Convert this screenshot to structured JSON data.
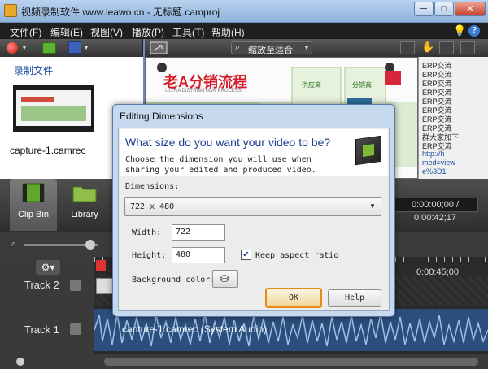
{
  "window": {
    "title": "视频录制软件 www.leawo.cn - 无标题.camproj",
    "min": "─",
    "max": "□",
    "close": "✕"
  },
  "menu": {
    "items": [
      "文件(F)",
      "编辑(E)",
      "视图(V)",
      "播放(P)",
      "工具(T)",
      "帮助(H)"
    ]
  },
  "help": {
    "question": "?"
  },
  "clip_bin": {
    "section_title": "录制文件",
    "clip_name": "capture-1.camrec"
  },
  "preview_toolbar": {
    "zoom_label": "缩放至适合"
  },
  "preview": {
    "banner_text": "老A分销流程",
    "sub_text": "ULTRA DISTRIBUTION PROCESS",
    "node1": "供应商",
    "node2": "分销商"
  },
  "side_panel": {
    "lines": [
      "ERP交流",
      "ERP交流",
      "ERP交流",
      "ERP交流",
      "ERP交流",
      "ERP交流",
      "ERP交流",
      "ERP交流",
      "群大家加下",
      "ERP交流",
      "http://h",
      "med=view",
      "e%3D1"
    ]
  },
  "tabs": {
    "clip_bin_label": "Clip Bin",
    "library_label": "Library"
  },
  "playback": {
    "time": "0:00:00;00 / 0:00:42;17"
  },
  "timeline": {
    "ruler_time": "0:00:45;00",
    "track2_label": "Track 2",
    "track1_label": "Track 1",
    "audio_clip_label": "capture-1.camrec (System Audio)"
  },
  "dialog": {
    "title": "Editing Dimensions",
    "question": "What size do you want your video to be?",
    "description": "Choose the dimension you will use when sharing your edited and produced video.",
    "dimensions_label": "Dimensions:",
    "dimensions_value": "722 x 480",
    "width_label": "Width:",
    "width_value": "722",
    "height_label": "Height:",
    "height_value": "480",
    "keep_aspect_label": "Keep aspect ratio",
    "keep_aspect_checked": true,
    "bg_color_label": "Background color:",
    "ok_label": "OK",
    "help_label": "Help"
  }
}
